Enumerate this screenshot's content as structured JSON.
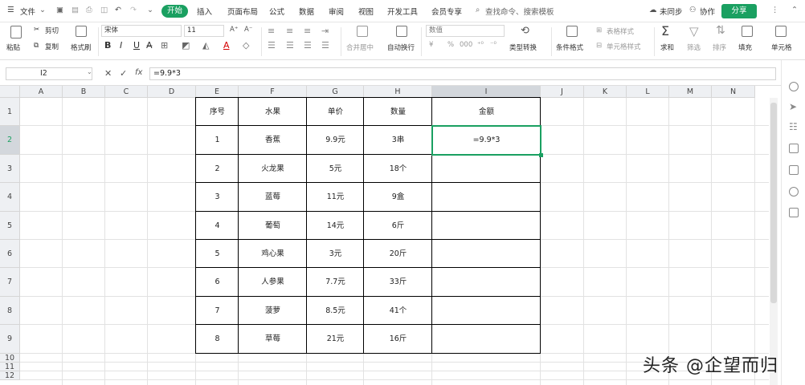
{
  "menubar": {
    "file": "文件",
    "tabs": [
      "开始",
      "插入",
      "页面布局",
      "公式",
      "数据",
      "审阅",
      "视图",
      "开发工具",
      "会员专享"
    ],
    "search": "查找命令、搜索模板",
    "sync": "未同步",
    "collab": "协作",
    "share": "分享"
  },
  "ribbon": {
    "paste": "粘贴",
    "cut": "剪切",
    "copy": "复制",
    "format_painter": "格式刷",
    "font_name": "宋体",
    "font_size": "11",
    "bold": "B",
    "italic": "I",
    "underline": "U",
    "merge": "合并居中",
    "wrap": "自动换行",
    "number_format": "数值",
    "percent": "%",
    "type_convert": "类型转换",
    "cond_format": "条件格式",
    "table_style": "表格样式",
    "cell_style": "单元格样式",
    "sum": "求和",
    "filter": "筛选",
    "sort": "排序",
    "fill": "填充",
    "cell": "单元格"
  },
  "formula_bar": {
    "cell_ref": "I2",
    "cancel": "✕",
    "confirm": "✓",
    "fx": "fx",
    "content": "=9.9*3"
  },
  "grid": {
    "columns": [
      "A",
      "B",
      "C",
      "D",
      "E",
      "F",
      "G",
      "H",
      "I",
      "J",
      "K",
      "L",
      "M",
      "N"
    ],
    "rows": [
      "1",
      "2",
      "3",
      "4",
      "5",
      "6",
      "7",
      "8",
      "9",
      "10",
      "11",
      "12"
    ],
    "headers": [
      "序号",
      "水果",
      "单价",
      "数量",
      "金额"
    ],
    "data": [
      [
        "1",
        "香蕉",
        "9.9元",
        "3串",
        "=9.9*3"
      ],
      [
        "2",
        "火龙果",
        "5元",
        "18个",
        ""
      ],
      [
        "3",
        "蓝莓",
        "11元",
        "9盒",
        ""
      ],
      [
        "4",
        "葡萄",
        "14元",
        "6斤",
        ""
      ],
      [
        "5",
        "鸡心果",
        "3元",
        "20斤",
        ""
      ],
      [
        "6",
        "人参果",
        "7.7元",
        "33斤",
        ""
      ],
      [
        "7",
        "菠萝",
        "8.5元",
        "41个",
        ""
      ],
      [
        "8",
        "草莓",
        "21元",
        "16斤",
        ""
      ]
    ],
    "active_cell": "I2"
  },
  "watermark": "头条 @企望而归"
}
